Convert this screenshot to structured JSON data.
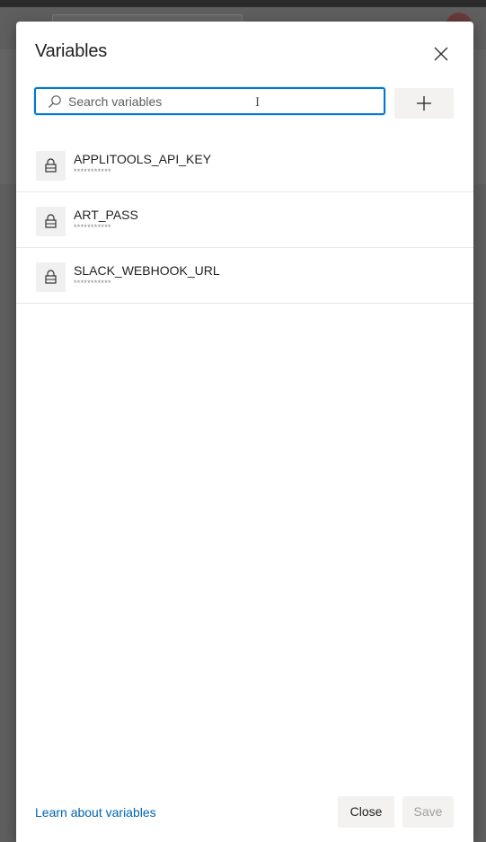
{
  "dialog": {
    "title": "Variables",
    "close_icon": "close-icon"
  },
  "search": {
    "placeholder": "Search variables",
    "value": "",
    "icon": "search-icon"
  },
  "add_button": {
    "icon": "plus-icon"
  },
  "variables": [
    {
      "name": "APPLITOOLS_API_KEY",
      "value": "***********",
      "icon": "lock-icon"
    },
    {
      "name": "ART_PASS",
      "value": "***********",
      "icon": "lock-icon"
    },
    {
      "name": "SLACK_WEBHOOK_URL",
      "value": "***********",
      "icon": "lock-icon"
    }
  ],
  "footer": {
    "learn_link": "Learn about variables",
    "close_label": "Close",
    "save_label": "Save"
  },
  "colors": {
    "accent": "#0078d4",
    "link": "#0063b1",
    "disabled_text": "#a19f9d"
  }
}
